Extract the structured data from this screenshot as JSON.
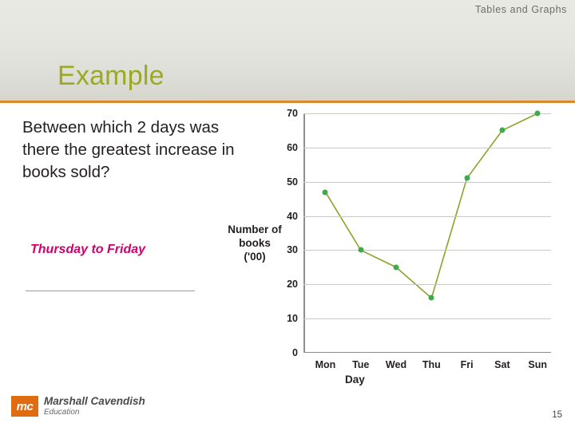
{
  "header": {
    "running_head": "Tables and Graphs",
    "title": "Example"
  },
  "body": {
    "question": "Between which 2 days was there the greatest increase in books sold?",
    "answer": "Thursday to Friday"
  },
  "footer": {
    "logo_mark": "mc",
    "logo_name": "Marshall Cavendish",
    "logo_sub": "Education",
    "page_number": "15"
  },
  "chart_data": {
    "type": "line",
    "title": "",
    "xlabel": "Day",
    "ylabel": "Number of books ('00)",
    "categories": [
      "Mon",
      "Tue",
      "Wed",
      "Thu",
      "Fri",
      "Sat",
      "Sun"
    ],
    "values": [
      47,
      30,
      25,
      16,
      51,
      65,
      70
    ],
    "ylim": [
      0,
      70
    ],
    "yticks": [
      0,
      10,
      20,
      30,
      40,
      50,
      60,
      70
    ],
    "grid": true,
    "legend": "none",
    "series_color": "#8aa32a",
    "marker_color": "#3faa4b"
  }
}
